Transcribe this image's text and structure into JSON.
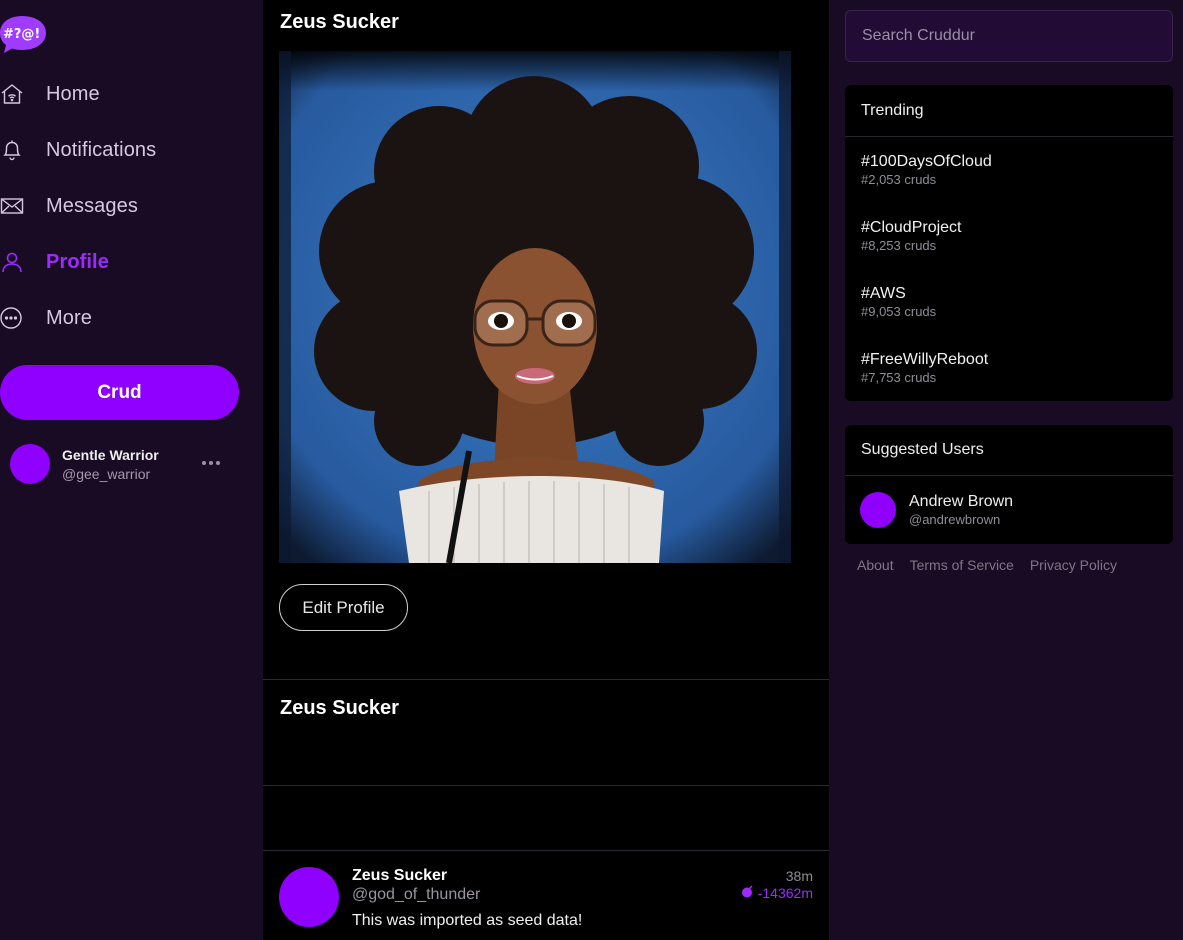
{
  "app": {
    "logo_text": "#?@!",
    "accent": "#8f00ff",
    "accent_text": "#9d2bff"
  },
  "nav": [
    {
      "label": "Home",
      "icon": "home-icon",
      "active": false
    },
    {
      "label": "Notifications",
      "icon": "bell-icon",
      "active": false
    },
    {
      "label": "Messages",
      "icon": "mail-icon",
      "active": false
    },
    {
      "label": "Profile",
      "icon": "user-icon",
      "active": true
    },
    {
      "label": "More",
      "icon": "more-circle-icon",
      "active": false
    }
  ],
  "crud_button": "Crud",
  "current_user": {
    "name": "Gentle Warrior",
    "handle": "@gee_warrior"
  },
  "profile": {
    "title": "Zeus Sucker",
    "edit_button": "Edit Profile",
    "section_name": "Zeus Sucker"
  },
  "post": {
    "name": "Zeus Sucker",
    "handle": "@god_of_thunder",
    "text": "This was imported as seed data!",
    "time": "38m",
    "expiry": "-14362m"
  },
  "search": {
    "placeholder": "Search Cruddur"
  },
  "trending": {
    "title": "Trending",
    "items": [
      {
        "tag": "#100DaysOfCloud",
        "count": "#2,053 cruds"
      },
      {
        "tag": "#CloudProject",
        "count": "#8,253 cruds"
      },
      {
        "tag": "#AWS",
        "count": "#9,053 cruds"
      },
      {
        "tag": "#FreeWillyReboot",
        "count": "#7,753 cruds"
      }
    ]
  },
  "suggested": {
    "title": "Suggested Users",
    "user": {
      "name": "Andrew Brown",
      "handle": "@andrewbrown"
    }
  },
  "footer": {
    "about": "About",
    "terms": "Terms of Service",
    "privacy": "Privacy Policy"
  }
}
